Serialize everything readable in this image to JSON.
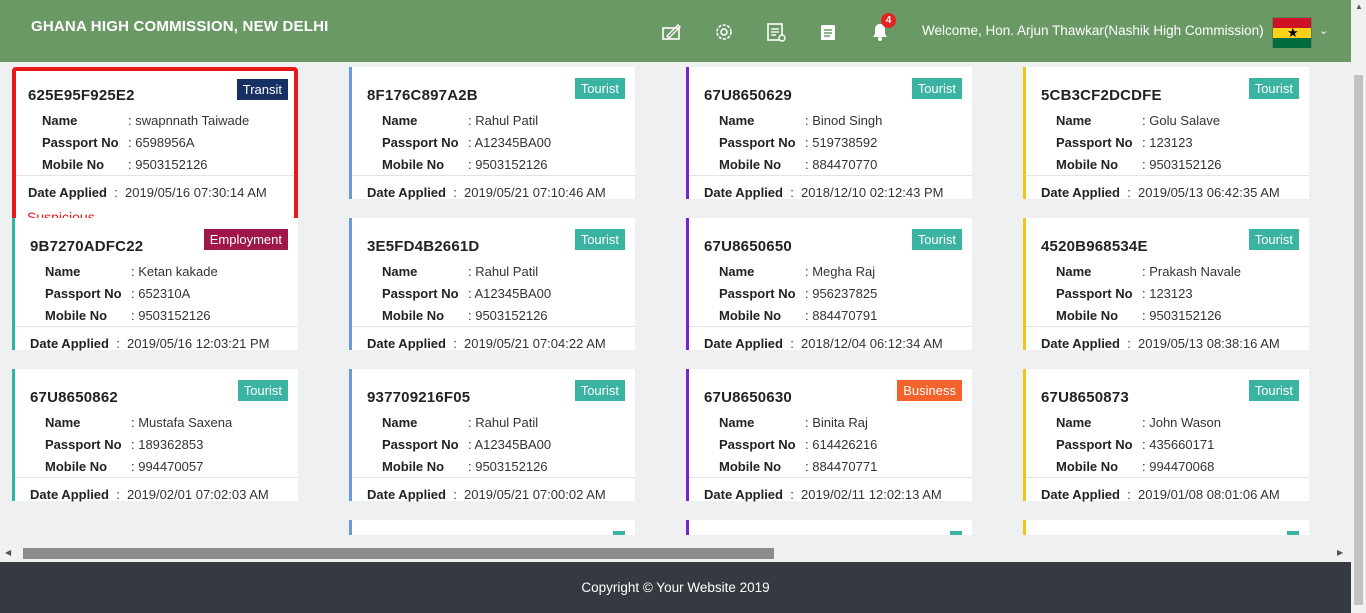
{
  "header": {
    "title": "GHANA HIGH COMMISSION, NEW DELHI",
    "welcome": "Welcome, Hon. Arjun Thawkar(Nashik High Commission)",
    "notification_count": "4",
    "icons": [
      "sign-icon",
      "gear-icon",
      "report-icon",
      "list-icon",
      "bell-icon"
    ]
  },
  "labels": {
    "name": "Name",
    "passport": "Passport No",
    "mobile": "Mobile No",
    "date_applied": "Date Applied"
  },
  "columns": [
    [
      {
        "id": "625E95F925E2",
        "type": "Transit",
        "name": ": swapnnath Taiwade",
        "passport": ": 6598956A",
        "mobile": ": 9503152126",
        "date": "2019/05/16 07:30:14 AM",
        "flag": "Suspicious"
      },
      {
        "id": "9B7270ADFC22",
        "type": "Employment",
        "name": ": Ketan kakade",
        "passport": ": 652310A",
        "mobile": ": 9503152126",
        "date": "2019/05/16 12:03:21 PM"
      },
      {
        "id": "67U8650862",
        "type": "Tourist",
        "name": ": Mustafa Saxena",
        "passport": ": 189362853",
        "mobile": ": 994470057",
        "date": "2019/02/01 07:02:03 AM"
      }
    ],
    [
      {
        "id": "8F176C897A2B",
        "type": "Tourist",
        "name": ": Rahul Patil",
        "passport": ": A12345BA00",
        "mobile": ": 9503152126",
        "date": "2019/05/21 07:10:46 AM"
      },
      {
        "id": "3E5FD4B2661D",
        "type": "Tourist",
        "name": ": Rahul Patil",
        "passport": ": A12345BA00",
        "mobile": ": 9503152126",
        "date": "2019/05/21 07:04:22 AM"
      },
      {
        "id": "937709216F05",
        "type": "Tourist",
        "name": ": Rahul Patil",
        "passport": ": A12345BA00",
        "mobile": ": 9503152126",
        "date": "2019/05/21 07:00:02 AM"
      }
    ],
    [
      {
        "id": "67U8650629",
        "type": "Tourist",
        "name": ": Binod Singh",
        "passport": ": 519738592",
        "mobile": ": 884470770",
        "date": "2018/12/10 02:12:43 PM"
      },
      {
        "id": "67U8650650",
        "type": "Tourist",
        "name": ": Megha Raj",
        "passport": ": 956237825",
        "mobile": ": 884470791",
        "date": "2018/12/04 06:12:34 AM"
      },
      {
        "id": "67U8650630",
        "type": "Business",
        "name": ": Binita Raj",
        "passport": ": 614426216",
        "mobile": ": 884470771",
        "date": "2019/02/11 12:02:13 AM"
      }
    ],
    [
      {
        "id": "5CB3CF2DCDFE",
        "type": "Tourist",
        "name": ": Golu Salave",
        "passport": ": 123123",
        "mobile": ": 9503152126",
        "date": "2019/05/13 06:42:35 AM"
      },
      {
        "id": "4520B968534E",
        "type": "Tourist",
        "name": ": Prakash Navale",
        "passport": ": 123123",
        "mobile": ": 9503152126",
        "date": "2019/05/13 08:38:16 AM"
      },
      {
        "id": "67U8650873",
        "type": "Tourist",
        "name": ": John Wason",
        "passport": ": 435660171",
        "mobile": ": 994470068",
        "date": "2019/01/08 08:01:06 AM"
      }
    ]
  ],
  "footer": {
    "copyright": "Copyright © Your Website 2019"
  },
  "colors": {
    "header": "#6b9965",
    "footer": "#343a40",
    "suspicious": "#e81818",
    "tourist": "#3bb3a3",
    "transit": "#163064",
    "employment": "#a0164a",
    "business": "#f4632b"
  }
}
